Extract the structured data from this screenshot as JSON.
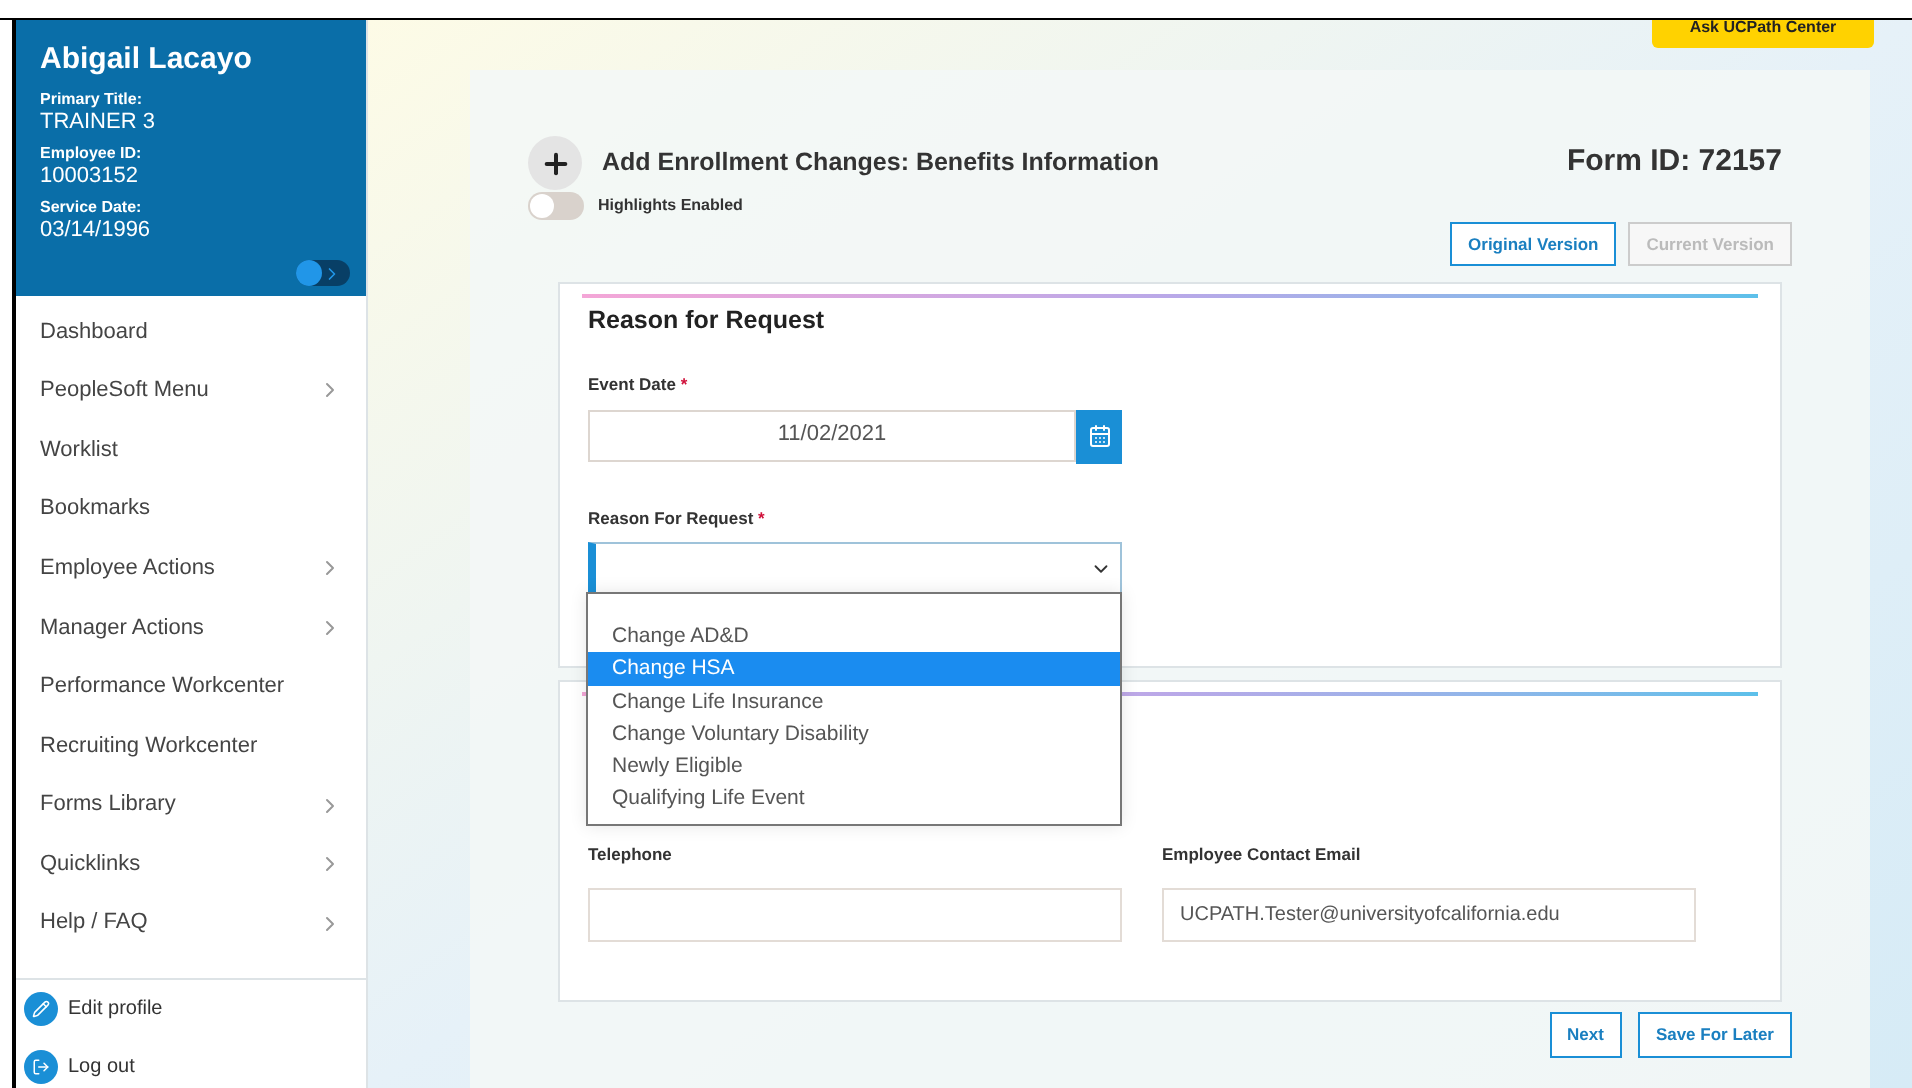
{
  "profile": {
    "name": "Abigail Lacayo",
    "fields": [
      {
        "label": "Primary Title:",
        "value": "TRAINER 3"
      },
      {
        "label": "Employee ID:",
        "value": "10003152"
      },
      {
        "label": "Service Date:",
        "value": "03/14/1996"
      }
    ]
  },
  "menu": [
    {
      "label": "Dashboard",
      "has_children": false
    },
    {
      "label": "PeopleSoft Menu",
      "has_children": true
    },
    {
      "label": "Worklist",
      "has_children": false
    },
    {
      "label": "Bookmarks",
      "has_children": false
    },
    {
      "label": "Employee Actions",
      "has_children": true
    },
    {
      "label": "Manager Actions",
      "has_children": true
    },
    {
      "label": "Performance Workcenter",
      "has_children": false
    },
    {
      "label": "Recruiting Workcenter",
      "has_children": false
    },
    {
      "label": "Forms Library",
      "has_children": true
    },
    {
      "label": "Quicklinks",
      "has_children": true
    },
    {
      "label": "Help / FAQ",
      "has_children": true
    }
  ],
  "footer_links": [
    {
      "label": "Edit profile",
      "kind": "edit"
    },
    {
      "label": "Log out",
      "kind": "logout"
    }
  ],
  "sidebar_switch": {
    "on": false
  },
  "help_button": "Ask UCPath Center",
  "form": {
    "title": "Add Enrollment Changes: Benefits Information",
    "form_id": "Form ID: 72157",
    "highlights": {
      "label": "Highlights Enabled",
      "on": false
    },
    "versions": [
      {
        "label": "Original Version",
        "disabled": false
      },
      {
        "label": "Current Version",
        "disabled": true
      }
    ],
    "section_title": "Reason for Request",
    "event_date": {
      "label": "Event Date",
      "required": "*",
      "value": "11/02/2021"
    },
    "reason": {
      "label": "Reason For Request",
      "required": "*",
      "options": [
        {
          "label": "Change AD&D",
          "selected": false
        },
        {
          "label": "Change HSA",
          "selected": true
        },
        {
          "label": "Change Life Insurance",
          "selected": false
        },
        {
          "label": "Change Voluntary Disability",
          "selected": false
        },
        {
          "label": "Newly Eligible",
          "selected": false
        },
        {
          "label": "Qualifying Life Event",
          "selected": false
        }
      ]
    },
    "telephone": {
      "label": "Telephone"
    },
    "email": {
      "label": "Employee Contact Email",
      "value": "UCPATH.Tester@universityofcalifornia.edu"
    },
    "buttons": [
      "Next",
      "Save For Later"
    ]
  }
}
